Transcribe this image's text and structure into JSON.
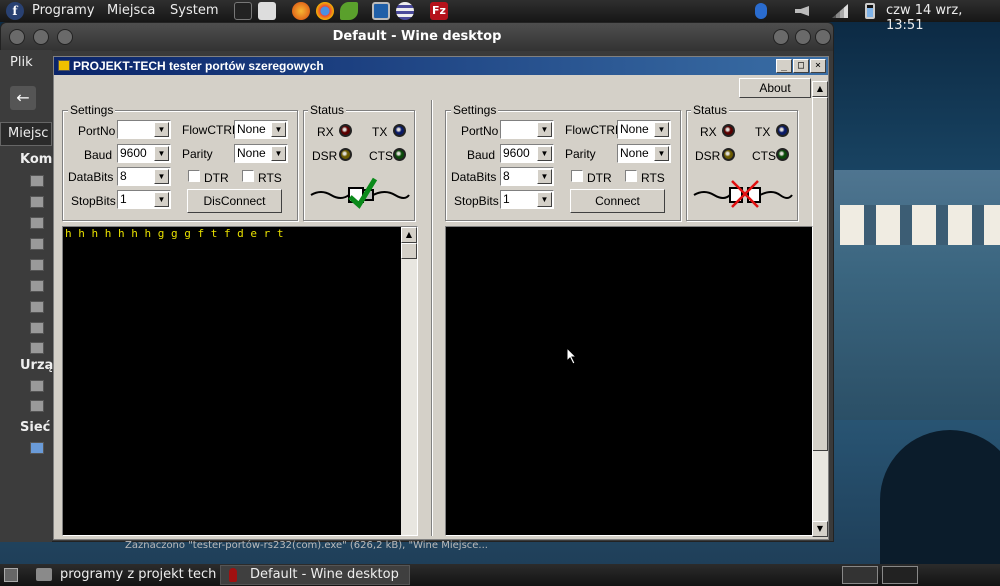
{
  "top_panel": {
    "menus": [
      "Programy",
      "Miejsca",
      "System"
    ],
    "clock": "czw 14 wrz, 13:51"
  },
  "outer_window": {
    "title": "Default - Wine desktop",
    "file_menu": "Plik",
    "places_label": "Miejsc",
    "section_computer": "Kom",
    "section_devices": "Urzą",
    "section_network": "Sieć"
  },
  "app": {
    "title": "PROJEKT-TECH tester portów szeregowych",
    "minimize": "_",
    "maximize": "□",
    "close": "×",
    "about_label": "About"
  },
  "panels": [
    {
      "settings_title": "Settings",
      "status_title": "Status",
      "portno_label": "PortNo",
      "portno_value": "",
      "baud_label": "Baud",
      "baud_value": "9600",
      "databits_label": "DataBits",
      "databits_value": "8",
      "stopbits_label": "StopBits",
      "stopbits_value": "1",
      "flowctrl_label": "FlowCTRL",
      "flowctrl_value": "None",
      "parity_label": "Parity",
      "parity_value": "None",
      "dtr_label": "DTR",
      "rts_label": "RTS",
      "connect_label": "DisConnect",
      "rx_label": "RX",
      "tx_label": "TX",
      "dsr_label": "DSR",
      "cts_label": "CTS",
      "connected": true,
      "terminal_text": "h h h h h h h g g g f t f d e r t"
    },
    {
      "settings_title": "Settings",
      "status_title": "Status",
      "portno_label": "PortNo",
      "portno_value": "",
      "baud_label": "Baud",
      "baud_value": "9600",
      "databits_label": "DataBits",
      "databits_value": "8",
      "stopbits_label": "StopBits",
      "stopbits_value": "1",
      "flowctrl_label": "FlowCTRL",
      "flowctrl_value": "None",
      "parity_label": "Parity",
      "parity_value": "None",
      "dtr_label": "DTR",
      "rts_label": "RTS",
      "connect_label": "Connect",
      "rx_label": "RX",
      "tx_label": "TX",
      "dsr_label": "DSR",
      "cts_label": "CTS",
      "connected": false,
      "terminal_text": ""
    }
  ],
  "status_strip": "Zaznaczono \"tester-portów-rs232(com).exe\" (626,2 kB), \"Wine Miejsce...",
  "taskbar": {
    "task1": "programy z projekt tech",
    "task2": "Default - Wine desktop"
  },
  "colors": {
    "led_red": "#5a0000",
    "led_blue": "#0a1a66",
    "led_yellow": "#6a5a00",
    "led_green": "#0a4a0a",
    "terminal_text": "#e8e000"
  }
}
